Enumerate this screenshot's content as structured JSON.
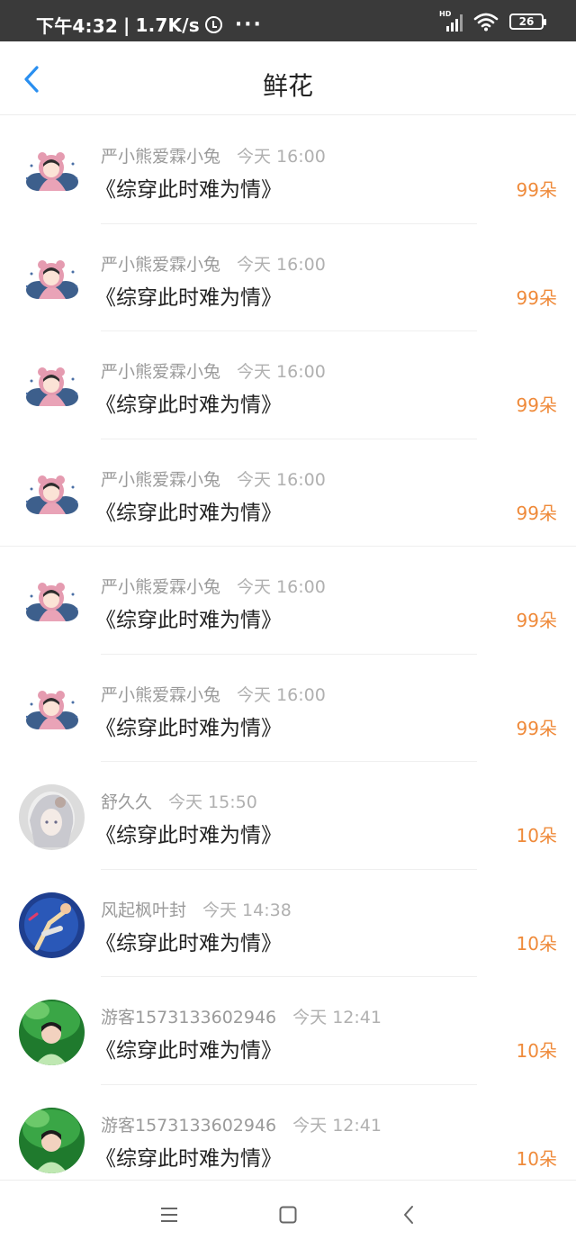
{
  "status_bar": {
    "time": "下午4:32",
    "net_speed": "1.7K/s",
    "battery": "26",
    "signal_label": "HD"
  },
  "header": {
    "title": "鲜花",
    "back_icon": "chevron-left-icon",
    "accent_color": "#2a8ff0"
  },
  "items": [
    {
      "user": "严小熊爱霖小兔",
      "time": "今天 16:00",
      "book": "《综穿此时难为情》",
      "count": "99朵",
      "avatar": "girl-pink-hood-icon"
    },
    {
      "user": "严小熊爱霖小兔",
      "time": "今天 16:00",
      "book": "《综穿此时难为情》",
      "count": "99朵",
      "avatar": "girl-pink-hood-icon"
    },
    {
      "user": "严小熊爱霖小兔",
      "time": "今天 16:00",
      "book": "《综穿此时难为情》",
      "count": "99朵",
      "avatar": "girl-pink-hood-icon"
    },
    {
      "user": "严小熊爱霖小兔",
      "time": "今天 16:00",
      "book": "《综穿此时难为情》",
      "count": "99朵",
      "avatar": "girl-pink-hood-icon"
    },
    {
      "user": "严小熊爱霖小兔",
      "time": "今天 16:00",
      "book": "《综穿此时难为情》",
      "count": "99朵",
      "avatar": "girl-pink-hood-icon"
    },
    {
      "user": "严小熊爱霖小兔",
      "time": "今天 16:00",
      "book": "《综穿此时难为情》",
      "count": "99朵",
      "avatar": "girl-pink-hood-icon"
    },
    {
      "user": "舒久久",
      "time": "今天 15:50",
      "book": "《综穿此时难为情》",
      "count": "10朵",
      "avatar": "silver-hair-girl-icon"
    },
    {
      "user": "风起枫叶封",
      "time": "今天 14:38",
      "book": "《综穿此时难为情》",
      "count": "10朵",
      "avatar": "dancer-blue-circle-icon"
    },
    {
      "user": "游客1573133602946",
      "time": "今天 12:41",
      "book": "《综穿此时难为情》",
      "count": "10朵",
      "avatar": "girl-green-leaves-icon"
    },
    {
      "user": "游客1573133602946",
      "time": "今天 12:41",
      "book": "《综穿此时难为情》",
      "count": "10朵",
      "avatar": "girl-green-leaves-icon"
    }
  ],
  "nav_bar": {
    "menu_icon": "menu-icon",
    "home_icon": "home-square-icon",
    "back_icon": "back-triangle-icon"
  },
  "colors": {
    "count": "#ef8a3a",
    "meta": "#9a9a9a",
    "status_bar_bg": "#3a3a3a"
  }
}
